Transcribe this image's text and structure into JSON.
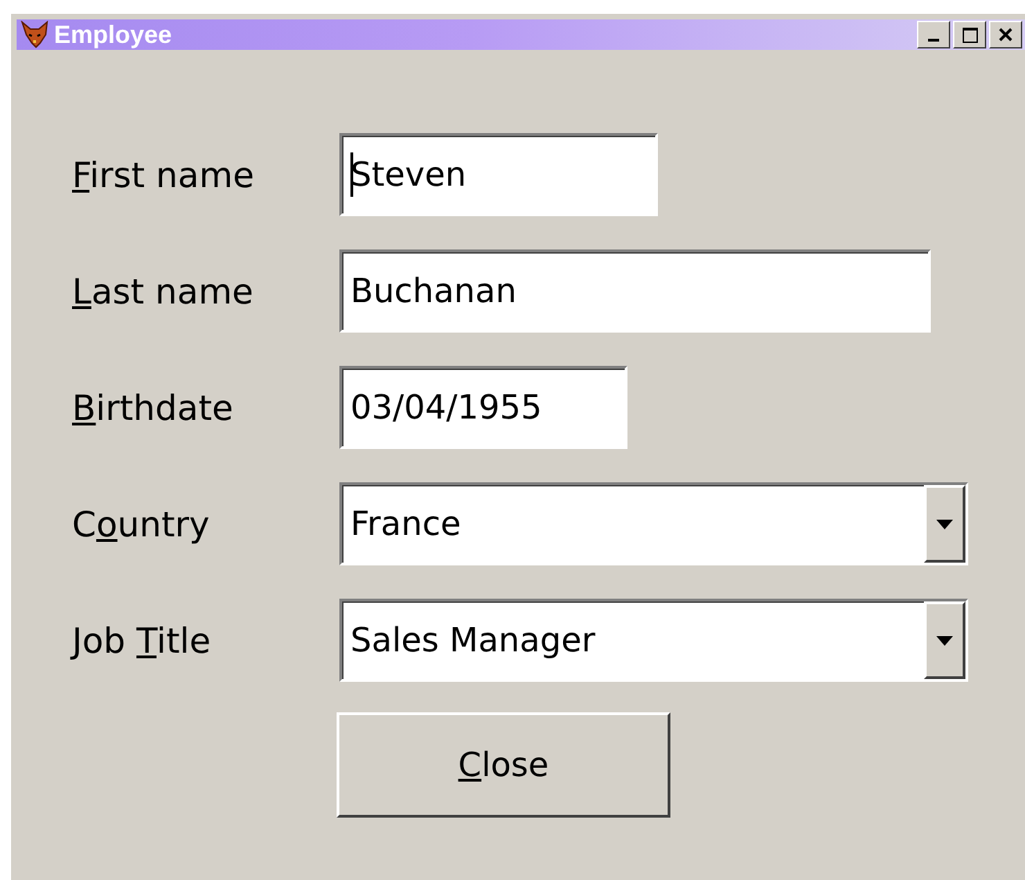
{
  "window": {
    "title": "Employee"
  },
  "fields": [
    {
      "kind": "text",
      "label": {
        "key": "F",
        "post": "irst name"
      },
      "value": "Steven",
      "focused": true
    },
    {
      "kind": "text",
      "label": {
        "key": "L",
        "post": "ast name"
      },
      "value": "Buchanan",
      "focused": false
    },
    {
      "kind": "text",
      "label": {
        "key": "B",
        "post": "irthdate"
      },
      "value": "03/04/1955",
      "focused": false
    },
    {
      "kind": "dropdown",
      "label": {
        "pre": "C",
        "key": "o",
        "post": "untry"
      },
      "value": "France",
      "focused": false
    },
    {
      "kind": "dropdown",
      "label": {
        "pre": "Job ",
        "key": "T",
        "post": "itle"
      },
      "value": "Sales Manager",
      "focused": false
    }
  ],
  "close_button": {
    "key": "C",
    "post": "lose"
  }
}
